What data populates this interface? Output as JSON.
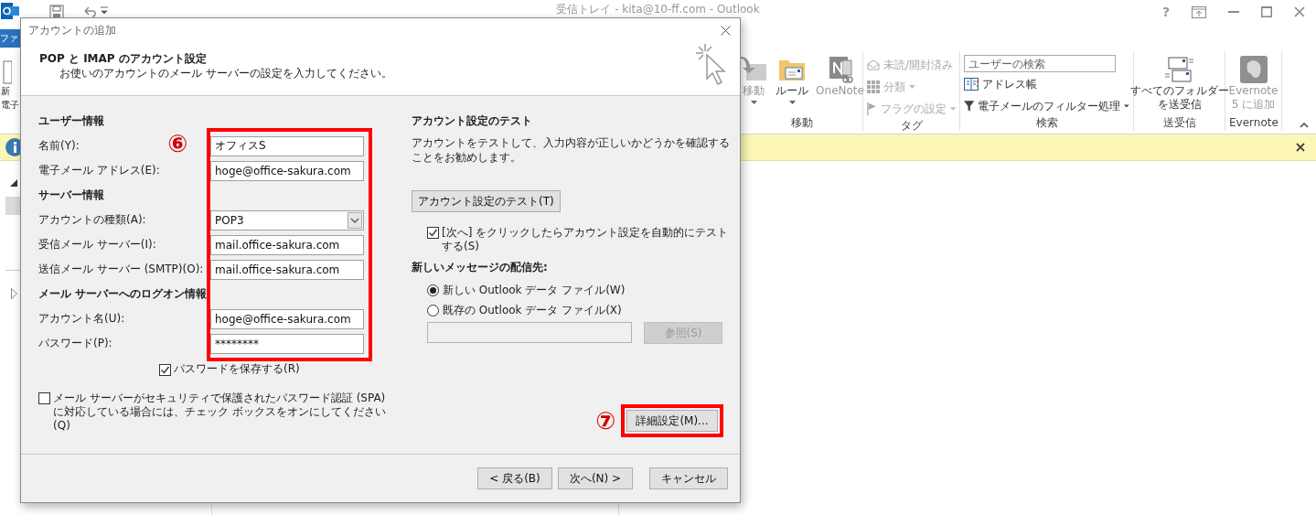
{
  "outlook": {
    "title": "受信トレイ - kita@10-ff.com - Outlook",
    "help": "?",
    "file_tab": "ファ",
    "cut_button_lines": [
      "新",
      "電子"
    ],
    "ribbon_groups": [
      {
        "label": "移動",
        "items": [
          {
            "kind": "large",
            "lines": [
              "移動"
            ],
            "disabled": true,
            "dropdown": true
          },
          {
            "kind": "large",
            "lines": [
              "ルール"
            ],
            "disabled": false,
            "dropdown": true
          },
          {
            "kind": "large",
            "lines": [
              "OneNote"
            ],
            "disabled": true,
            "dropdown": false
          }
        ]
      },
      {
        "label": "タグ",
        "items": [
          {
            "kind": "small",
            "label": "未読/開封済み",
            "disabled": true,
            "dropdown": false
          },
          {
            "kind": "small",
            "label": "分類",
            "disabled": true,
            "dropdown": true
          },
          {
            "kind": "small",
            "label": "フラグの設定",
            "disabled": true,
            "dropdown": true
          }
        ]
      },
      {
        "label": "検索",
        "items": [
          {
            "kind": "search",
            "placeholder": "ユーザーの検索"
          },
          {
            "kind": "small",
            "label": "アドレス帳",
            "disabled": false,
            "dropdown": false
          },
          {
            "kind": "small",
            "label": "電子メールのフィルター処理",
            "disabled": false,
            "dropdown": true
          }
        ]
      },
      {
        "label": "送受信",
        "items": [
          {
            "kind": "large",
            "lines": [
              "すべてのフォルダー",
              "を送受信"
            ],
            "disabled": false,
            "dropdown": false
          }
        ]
      },
      {
        "label": "Evernote",
        "items": [
          {
            "kind": "large",
            "lines": [
              "Evernote",
              "5 に追加"
            ],
            "disabled": true,
            "dropdown": false
          }
        ]
      }
    ]
  },
  "dialog": {
    "title": "アカウントの追加",
    "heading": "POP と IMAP のアカウント設定",
    "subheading": "お使いのアカウントのメール サーバーの設定を入力してください。",
    "sections": [
      {
        "title": "ユーザー情報",
        "fields": [
          {
            "kind": "text",
            "label": "名前(Y):",
            "value": "オフィスS"
          },
          {
            "kind": "text",
            "label": "電子メール アドレス(E):",
            "value": "hoge@office-sakura.com"
          }
        ]
      },
      {
        "title": "サーバー情報",
        "fields": [
          {
            "kind": "dropdown",
            "label": "アカウントの種類(A):",
            "value": "POP3"
          },
          {
            "kind": "text",
            "label": "受信メール サーバー(I):",
            "value": "mail.office-sakura.com"
          },
          {
            "kind": "text",
            "label": "送信メール サーバー (SMTP)(O):",
            "value": "mail.office-sakura.com"
          }
        ]
      },
      {
        "title": "メール サーバーへのログオン情報",
        "fields": [
          {
            "kind": "text",
            "label": "アカウント名(U):",
            "value": "hoge@office-sakura.com"
          },
          {
            "kind": "text",
            "label": "パスワード(P):",
            "value": "********"
          }
        ]
      }
    ],
    "remember_password": {
      "label": "パスワードを保存する(R)",
      "checked": true
    },
    "spa": {
      "label": "メール サーバーがセキュリティで保護されたパスワード認証 (SPA) に対応している場合には、チェック ボックスをオンにしてください(Q)",
      "checked": false
    },
    "test": {
      "title": "アカウント設定のテスト",
      "description": "アカウントをテストして、入力内容が正しいかどうかを確認することをお勧めします。",
      "button": "アカウント設定のテスト(T)",
      "auto_test": {
        "label": "[次へ] をクリックしたらアカウント設定を自動的にテストする(S)",
        "checked": true
      }
    },
    "delivery": {
      "title": "新しいメッセージの配信先:",
      "options": [
        {
          "label": "新しい Outlook データ ファイル(W)",
          "selected": true
        },
        {
          "label": "既存の Outlook データ ファイル(X)",
          "selected": false
        }
      ],
      "browse": {
        "label": "参照(S)",
        "disabled": true
      }
    },
    "more_settings": "詳細設定(M)...",
    "buttons": [
      "< 戻る(B)",
      "次へ(N) >",
      "キャンセル"
    ]
  },
  "annotations": [
    "⑥",
    "⑦"
  ]
}
